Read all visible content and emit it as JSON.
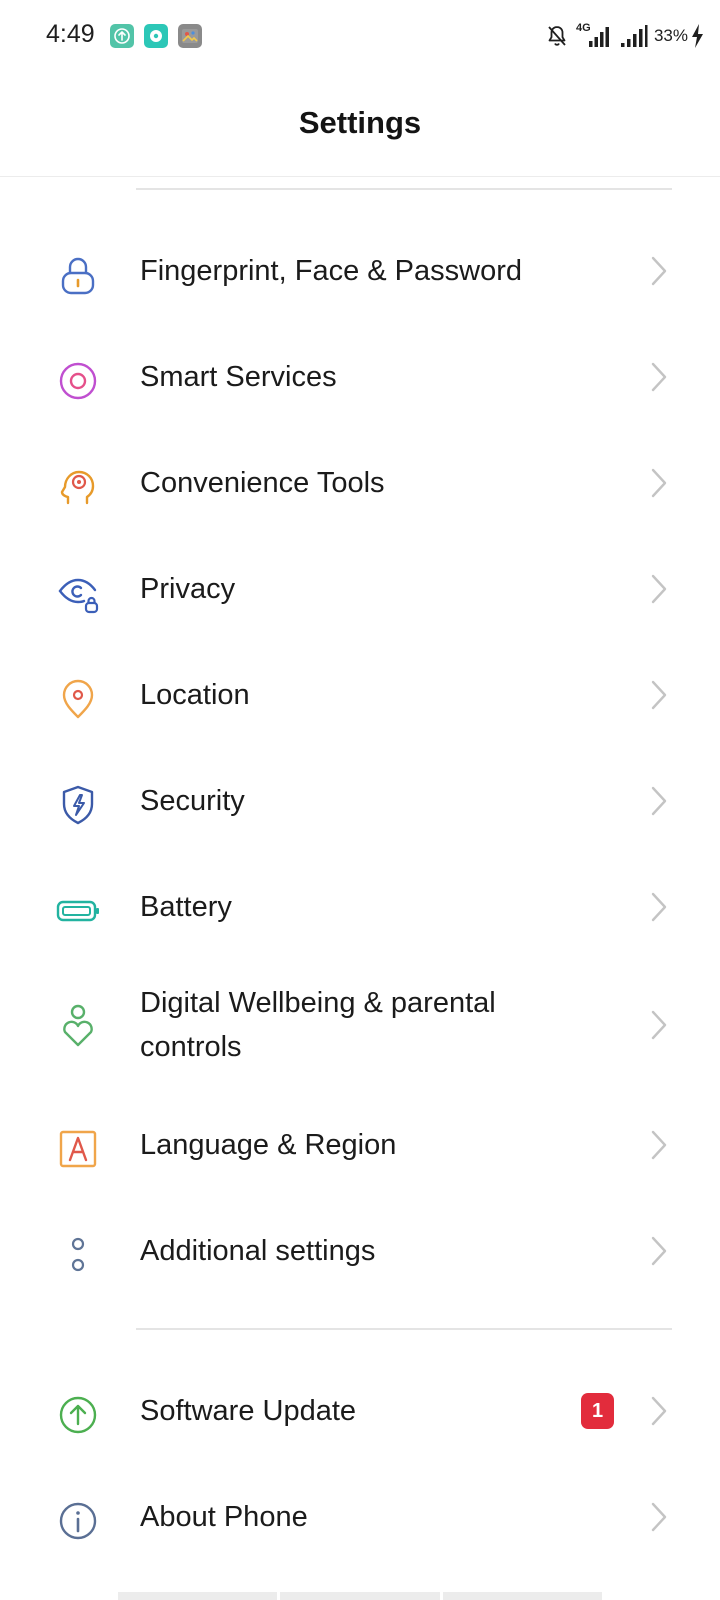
{
  "status_bar": {
    "time": "4:49",
    "network_label": "4G",
    "battery_percent": "33%",
    "notification_icons": [
      "upload-app-icon",
      "music-app-icon",
      "photos-app-icon"
    ],
    "system_icons": [
      "bell-off-icon",
      "signal-4g-icon",
      "signal-icon",
      "battery-charging-icon"
    ]
  },
  "header": {
    "title": "Settings"
  },
  "menu": {
    "items": [
      {
        "label": "Fingerprint, Face & Password",
        "icon": "lock-icon",
        "color": "#4a6fc4"
      },
      {
        "label": "Smart Services",
        "icon": "smart-services-icon",
        "color": "#c04fd0"
      },
      {
        "label": "Convenience Tools",
        "icon": "head-target-icon",
        "color": "#e79a2a"
      },
      {
        "label": "Privacy",
        "icon": "eye-lock-icon",
        "color": "#3b5fb8"
      },
      {
        "label": "Location",
        "icon": "location-pin-icon",
        "color": "#f0a54a"
      },
      {
        "label": "Security",
        "icon": "shield-bolt-icon",
        "color": "#3b5aa8"
      },
      {
        "label": "Battery",
        "icon": "battery-icon",
        "color": "#22b3a0"
      },
      {
        "label": "Digital Wellbeing & parental controls",
        "icon": "wellbeing-heart-icon",
        "color": "#58b06a"
      },
      {
        "label": "Language & Region",
        "icon": "language-a-icon",
        "color": "#e9853a"
      },
      {
        "label": "Additional settings",
        "icon": "dots-vertical-icon",
        "color": "#5f7496"
      }
    ],
    "bottom_items": [
      {
        "label": "Software Update",
        "icon": "arrow-up-circle-icon",
        "color": "#4caf50",
        "badge": "1"
      },
      {
        "label": "About Phone",
        "icon": "info-circle-icon",
        "color": "#5a6f94"
      }
    ]
  },
  "colors": {
    "badge": "#e22c3c",
    "chevron": "#c4c4c4",
    "divider": "#e4e4e4"
  }
}
